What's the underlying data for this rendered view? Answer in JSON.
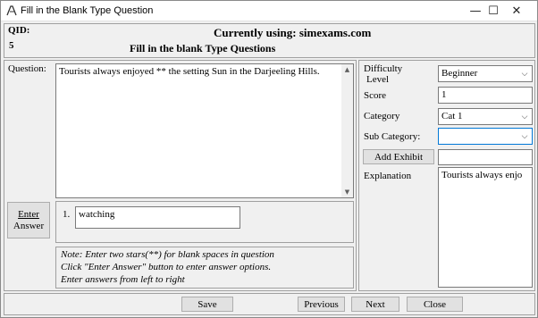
{
  "window": {
    "title": "Fill in the Blank Type Question",
    "minimize": "—",
    "maximize": "☐",
    "close": "✕"
  },
  "header": {
    "qid_label": "QID:",
    "qid_value": "5",
    "source": "Currently using: simexams.com",
    "heading": "Fill in the blank Type Questions"
  },
  "question": {
    "label": "Question:",
    "text": "Tourists always enjoyed ** the setting Sun in the Darjeeling Hills."
  },
  "enter_answer": {
    "line1": "Enter",
    "line2": "Answer"
  },
  "answers": [
    {
      "num": "1.",
      "value": "watching"
    }
  ],
  "note": {
    "line1": "Note: Enter two stars(**) for blank spaces in question",
    "line2": "Click \"Enter Answer\" button to enter answer options.",
    "line3": "Enter answers from left to right"
  },
  "side": {
    "difficulty_label_1": "Difficulty",
    "difficulty_label_2": "Level",
    "difficulty_value": "Beginner",
    "score_label": "Score",
    "score_value": "1",
    "category_label": "Category",
    "category_value": "Cat 1",
    "subcategory_label": "Sub Category:",
    "subcategory_value": "",
    "add_exhibit": "Add Exhibit",
    "exhibit_value": "",
    "explanation_label": "Explanation",
    "explanation_text": "Tourists always enjo"
  },
  "footer": {
    "save": "Save",
    "previous": "Previous",
    "next": "Next",
    "close": "Close"
  }
}
